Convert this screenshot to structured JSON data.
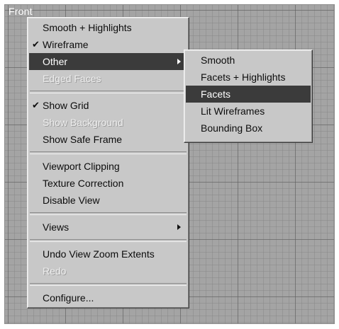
{
  "viewport": {
    "label": "Front"
  },
  "main_menu": {
    "items": [
      {
        "label": "Smooth + Highlights"
      },
      {
        "label": "Wireframe",
        "checked": true
      },
      {
        "label": "Other",
        "highlighted": true,
        "has_submenu": true
      },
      {
        "label": "Edged Faces",
        "disabled": true
      },
      {
        "label": "Show Grid",
        "checked": true
      },
      {
        "label": "Show Background",
        "disabled": true
      },
      {
        "label": "Show Safe Frame"
      },
      {
        "label": "Viewport Clipping"
      },
      {
        "label": "Texture Correction"
      },
      {
        "label": "Disable View"
      },
      {
        "label": "Views",
        "has_submenu": true
      },
      {
        "label": "Undo View Zoom Extents"
      },
      {
        "label": "Redo",
        "disabled": true
      },
      {
        "label": "Configure..."
      }
    ]
  },
  "sub_menu": {
    "items": [
      {
        "label": "Smooth"
      },
      {
        "label": "Facets + Highlights"
      },
      {
        "label": "Facets",
        "highlighted": true
      },
      {
        "label": "Lit Wireframes"
      },
      {
        "label": "Bounding Box"
      }
    ]
  },
  "check_glyph": "✔",
  "colors": {
    "viewport_background": "#a4a4a4",
    "menu_background": "#c8c8c8",
    "highlight_background": "#3b3b3b",
    "highlight_text": "#ffffff"
  }
}
